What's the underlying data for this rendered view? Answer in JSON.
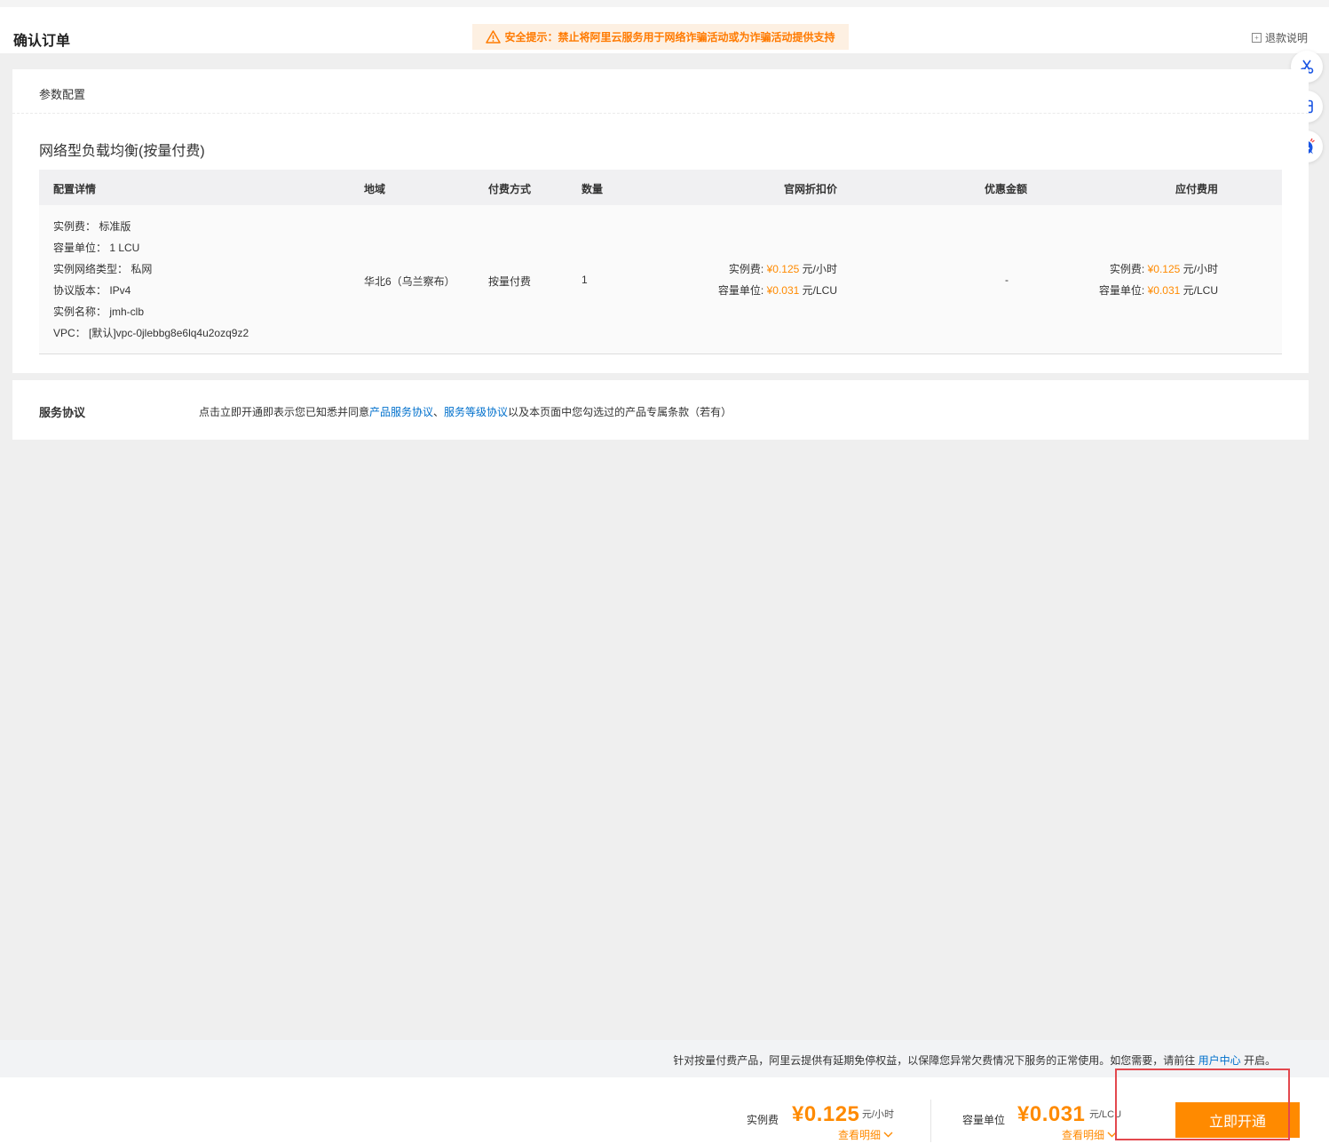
{
  "header": {
    "title": "确认订单",
    "warning": "安全提示：禁止将阿里云服务用于网络诈骗活动或为诈骗活动提供支持",
    "refund_link": "退款说明"
  },
  "side_tools": [
    "scissors-icon",
    "storefront-icon",
    "support-chat-icon"
  ],
  "config": {
    "section_title": "参数配置",
    "product_title": "网络型负载均衡(按量付费)",
    "columns": [
      "配置详情",
      "地域",
      "付费方式",
      "数量",
      "官网折扣价",
      "优惠金额",
      "应付费用"
    ],
    "row": {
      "specs": [
        "实例费：  标准版",
        "容量单位：  1 LCU",
        "实例网络类型：  私网",
        "协议版本：  IPv4",
        "实例名称：  jmh-clb",
        "VPC：  [默认]vpc-0jlebbg8e6lq4u2ozq9z2"
      ],
      "region": "华北6（乌兰察布）",
      "billing": "按量付费",
      "quantity": "1",
      "list_price": {
        "instance_label": "实例费:",
        "instance_price": "¥0.125",
        "instance_unit": "元/小时",
        "lcu_label": "容量单位:",
        "lcu_price": "¥0.031",
        "lcu_unit": "元/LCU"
      },
      "discount": "-",
      "payable": {
        "instance_label": "实例费:",
        "instance_price": "¥0.125",
        "instance_unit": "元/小时",
        "lcu_label": "容量单位:",
        "lcu_price": "¥0.031",
        "lcu_unit": "元/LCU"
      }
    }
  },
  "agreement": {
    "label": "服务协议",
    "text_before": "点击立即开通即表示您已知悉并同意",
    "link1": "产品服务协议",
    "sep": "、",
    "link2": "服务等级协议",
    "text_after": "以及本页面中您勾选过的产品专属条款（若有）"
  },
  "notice": {
    "text": "针对按量付费产品，阿里云提供有延期免停权益，以保障您异常欠费情况下服务的正常使用。如您需要，请前往",
    "link": "用户中心",
    "suffix": "开启。"
  },
  "footer": {
    "instance_label": "实例费",
    "instance_amount": "¥0.125",
    "instance_unit": "元/小时",
    "lcu_label": "容量单位",
    "lcu_amount": "¥0.031",
    "lcu_unit": "元/LCU",
    "detail_label": "查看明细",
    "open_button": "立即开通"
  },
  "colors": {
    "accent": "#ff8a00",
    "link": "#0070cc",
    "warning_bg": "#fdf0e2",
    "highlight_frame": "#e3484e"
  }
}
